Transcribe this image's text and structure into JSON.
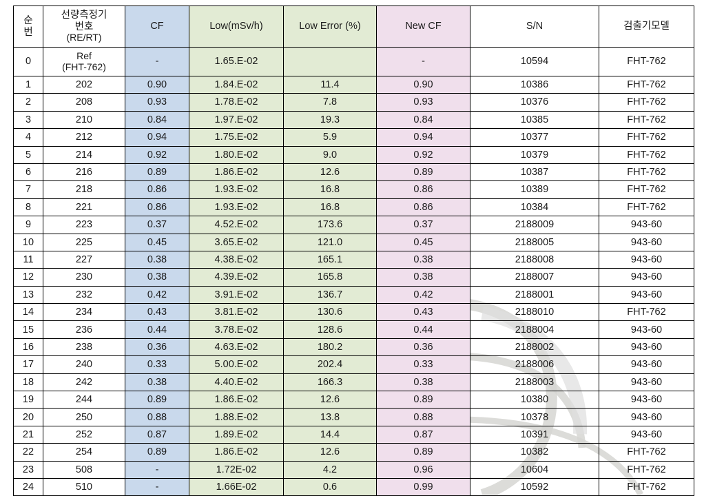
{
  "table": {
    "headers": [
      {
        "key": "index",
        "label": "순 번",
        "lines": [
          "순",
          "번"
        ],
        "color": "#ffffff"
      },
      {
        "key": "detector",
        "label": "선량측정기 번호 (RE/RT)",
        "lines": [
          "선량측정기",
          "번호",
          "(RE/RT)"
        ],
        "color": "#ffffff"
      },
      {
        "key": "cf",
        "label": "CF",
        "lines": [
          "CF"
        ],
        "color": "#c9d9ec"
      },
      {
        "key": "low",
        "label": "Low(mSv/h)",
        "lines": [
          "Low(mSv/h)"
        ],
        "color": "#e2ebd4"
      },
      {
        "key": "low_error",
        "label": "Low Error (%)",
        "lines": [
          "Low Error (%)"
        ],
        "color": "#e2ebd4"
      },
      {
        "key": "new_cf",
        "label": "New CF",
        "lines": [
          "New CF"
        ],
        "color": "#f0dfec"
      },
      {
        "key": "sn",
        "label": "S/N",
        "lines": [
          "S/N"
        ],
        "color": "#ffffff"
      },
      {
        "key": "model",
        "label": "검출기모델",
        "lines": [
          "검출기모델"
        ],
        "color": "#ffffff"
      }
    ],
    "ref_row": {
      "index": "0",
      "detector_line1": "Ref",
      "detector_line2": "(FHT-762)",
      "cf": "-",
      "low": "1.65.E-02",
      "low_error": "",
      "new_cf": "-",
      "sn": "10594",
      "model": "FHT-762"
    },
    "rows": [
      {
        "index": "1",
        "detector": "202",
        "cf": "0.90",
        "low": "1.84.E-02",
        "low_error": "11.4",
        "new_cf": "0.90",
        "sn": "10386",
        "model": "FHT-762"
      },
      {
        "index": "2",
        "detector": "208",
        "cf": "0.93",
        "low": "1.78.E-02",
        "low_error": "7.8",
        "new_cf": "0.93",
        "sn": "10376",
        "model": "FHT-762"
      },
      {
        "index": "3",
        "detector": "210",
        "cf": "0.84",
        "low": "1.97.E-02",
        "low_error": "19.3",
        "new_cf": "0.84",
        "sn": "10385",
        "model": "FHT-762"
      },
      {
        "index": "4",
        "detector": "212",
        "cf": "0.94",
        "low": "1.75.E-02",
        "low_error": "5.9",
        "new_cf": "0.94",
        "sn": "10377",
        "model": "FHT-762"
      },
      {
        "index": "5",
        "detector": "214",
        "cf": "0.92",
        "low": "1.80.E-02",
        "low_error": "9.0",
        "new_cf": "0.92",
        "sn": "10379",
        "model": "FHT-762"
      },
      {
        "index": "6",
        "detector": "216",
        "cf": "0.89",
        "low": "1.86.E-02",
        "low_error": "12.6",
        "new_cf": "0.89",
        "sn": "10387",
        "model": "FHT-762"
      },
      {
        "index": "7",
        "detector": "218",
        "cf": "0.86",
        "low": "1.93.E-02",
        "low_error": "16.8",
        "new_cf": "0.86",
        "sn": "10389",
        "model": "FHT-762"
      },
      {
        "index": "8",
        "detector": "221",
        "cf": "0.86",
        "low": "1.93.E-02",
        "low_error": "16.8",
        "new_cf": "0.86",
        "sn": "10384",
        "model": "FHT-762"
      },
      {
        "index": "9",
        "detector": "223",
        "cf": "0.37",
        "low": "4.52.E-02",
        "low_error": "173.6",
        "new_cf": "0.37",
        "sn": "2188009",
        "model": "943-60"
      },
      {
        "index": "10",
        "detector": "225",
        "cf": "0.45",
        "low": "3.65.E-02",
        "low_error": "121.0",
        "new_cf": "0.45",
        "sn": "2188005",
        "model": "943-60"
      },
      {
        "index": "11",
        "detector": "227",
        "cf": "0.38",
        "low": "4.38.E-02",
        "low_error": "165.1",
        "new_cf": "0.38",
        "sn": "2188008",
        "model": "943-60"
      },
      {
        "index": "12",
        "detector": "230",
        "cf": "0.38",
        "low": "4.39.E-02",
        "low_error": "165.8",
        "new_cf": "0.38",
        "sn": "2188007",
        "model": "943-60"
      },
      {
        "index": "13",
        "detector": "232",
        "cf": "0.42",
        "low": "3.91.E-02",
        "low_error": "136.7",
        "new_cf": "0.42",
        "sn": "2188001",
        "model": "943-60"
      },
      {
        "index": "14",
        "detector": "234",
        "cf": "0.43",
        "low": "3.81.E-02",
        "low_error": "130.6",
        "new_cf": "0.43",
        "sn": "2188010",
        "model": "FHT-762"
      },
      {
        "index": "15",
        "detector": "236",
        "cf": "0.44",
        "low": "3.78.E-02",
        "low_error": "128.6",
        "new_cf": "0.44",
        "sn": "2188004",
        "model": "943-60"
      },
      {
        "index": "16",
        "detector": "238",
        "cf": "0.36",
        "low": "4.63.E-02",
        "low_error": "180.2",
        "new_cf": "0.36",
        "sn": "2188002",
        "model": "943-60"
      },
      {
        "index": "17",
        "detector": "240",
        "cf": "0.33",
        "low": "5.00.E-02",
        "low_error": "202.4",
        "new_cf": "0.33",
        "sn": "2188006",
        "model": "943-60"
      },
      {
        "index": "18",
        "detector": "242",
        "cf": "0.38",
        "low": "4.40.E-02",
        "low_error": "166.3",
        "new_cf": "0.38",
        "sn": "2188003",
        "model": "943-60"
      },
      {
        "index": "19",
        "detector": "244",
        "cf": "0.89",
        "low": "1.86.E-02",
        "low_error": "12.6",
        "new_cf": "0.89",
        "sn": "10380",
        "model": "943-60"
      },
      {
        "index": "20",
        "detector": "250",
        "cf": "0.88",
        "low": "1.88.E-02",
        "low_error": "13.8",
        "new_cf": "0.88",
        "sn": "10378",
        "model": "943-60"
      },
      {
        "index": "21",
        "detector": "252",
        "cf": "0.87",
        "low": "1.89.E-02",
        "low_error": "14.4",
        "new_cf": "0.87",
        "sn": "10391",
        "model": "943-60"
      },
      {
        "index": "22",
        "detector": "254",
        "cf": "0.89",
        "low": "1.86.E-02",
        "low_error": "12.6",
        "new_cf": "0.89",
        "sn": "10382",
        "model": "FHT-762"
      },
      {
        "index": "23",
        "detector": "508",
        "cf": "-",
        "low": "1.72E-02",
        "low_error": "4.2",
        "new_cf": "0.96",
        "sn": "10604",
        "model": "FHT-762"
      },
      {
        "index": "24",
        "detector": "510",
        "cf": "-",
        "low": "1.66E-02",
        "low_error": "0.6",
        "new_cf": "0.99",
        "sn": "10592",
        "model": "FHT-762"
      }
    ]
  },
  "colors": {
    "cf_column": "#c9d9ec",
    "low_column": "#e2ebd4",
    "new_cf_column": "#f0dfec",
    "border": "#000000",
    "text": "#1b1b1b",
    "watermark": "#d8d8d4"
  }
}
